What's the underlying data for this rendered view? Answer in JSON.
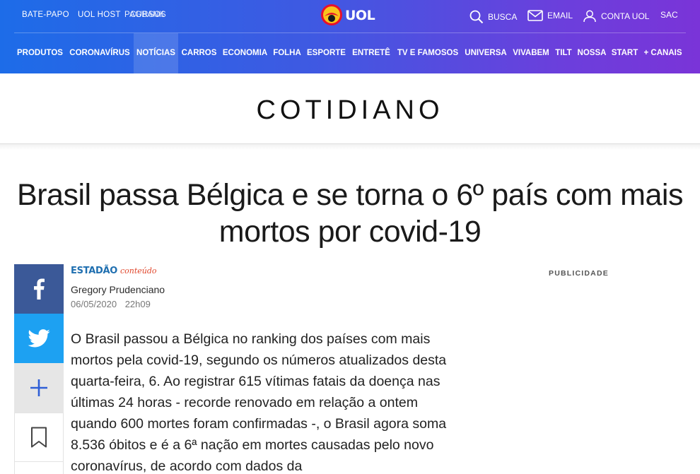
{
  "top_links": [
    {
      "label": "Bate-papo"
    },
    {
      "label": "UOL Host"
    },
    {
      "label": "PagBank"
    },
    {
      "label": "Cursos"
    }
  ],
  "logo": {
    "text": "UOL",
    "colors": {
      "sun": "#f9c41c",
      "ring": "#e8102c"
    }
  },
  "utilities": {
    "search": {
      "label": "Busca",
      "icon": "search-icon"
    },
    "email": {
      "label": "Email",
      "icon": "envelope-icon"
    },
    "account": {
      "label": "Conta UOL",
      "icon": "user-icon"
    },
    "sac": {
      "label": "SAC"
    }
  },
  "nav": [
    {
      "label": "PRODUTOS"
    },
    {
      "label": "CORONAVÍRUS"
    },
    {
      "label": "NOTÍCIAS",
      "active": true
    },
    {
      "label": "CARROS"
    },
    {
      "label": "ECONOMIA"
    },
    {
      "label": "FOLHA"
    },
    {
      "label": "ESPORTE"
    },
    {
      "label": "ENTRETÊ"
    },
    {
      "label": "TV E FAMOSOS"
    },
    {
      "label": "UNIVERSA"
    },
    {
      "label": "VIVABEM"
    },
    {
      "label": "TILT"
    },
    {
      "label": "NOSSA"
    },
    {
      "label": "START"
    },
    {
      "label": "+ CANAIS"
    }
  ],
  "section": {
    "title": "COTIDIANO"
  },
  "article": {
    "headline": "Brasil passa Bélgica e se torna o 6º país com mais mortos por covid-19",
    "source": {
      "main": "ESTADÃO",
      "sub": "conteúdo"
    },
    "author": "Gregory Prudenciano",
    "date": "06/05/2020",
    "time": "22h09",
    "body": "O Brasil passou a Bélgica no ranking dos países com mais mortos pela covid-19, segundo os números atualizados desta quarta-feira, 6. Ao registrar 615 vítimas fatais da doença nas últimas 24 horas - recorde renovado em relação a ontem quando 600 mortes foram confirmadas -, o Brasil agora soma 8.536 óbitos e é a 6ª nação em mortes causadas pelo novo coronavírus, de acordo com dados da"
  },
  "share": {
    "facebook": {
      "icon": "facebook-icon",
      "color": "#3b5998"
    },
    "twitter": {
      "icon": "twitter-icon",
      "color": "#1da1f2"
    },
    "more": {
      "icon": "plus-icon"
    },
    "save": {
      "icon": "bookmark-icon"
    }
  },
  "ad": {
    "label": "PUBLICIDADE"
  },
  "colors": {
    "header_start": "#1d6ce8",
    "header_end": "#7a34d8"
  }
}
